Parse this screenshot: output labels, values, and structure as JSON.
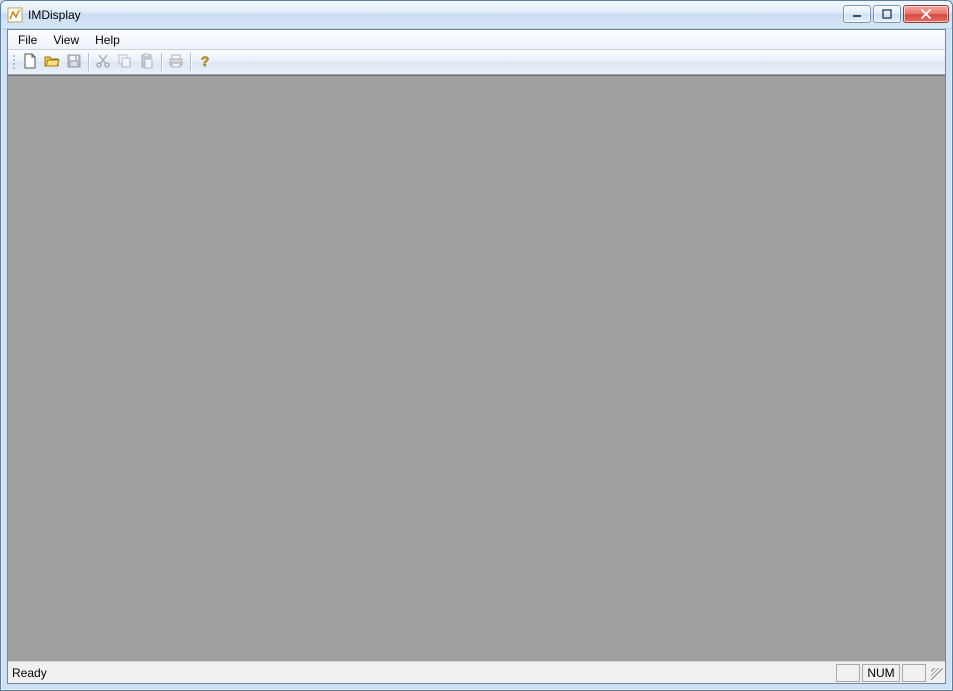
{
  "window": {
    "title": "IMDisplay"
  },
  "menu": {
    "file": "File",
    "view": "View",
    "help": "Help"
  },
  "toolbar": {
    "icons": {
      "new": "new-file-icon",
      "open": "open-folder-icon",
      "save": "save-disk-icon",
      "cut": "scissors-icon",
      "copy": "copy-icon",
      "paste": "paste-icon",
      "print": "printer-icon",
      "help": "help-question-icon"
    }
  },
  "status": {
    "ready": "Ready",
    "num": "NUM"
  }
}
